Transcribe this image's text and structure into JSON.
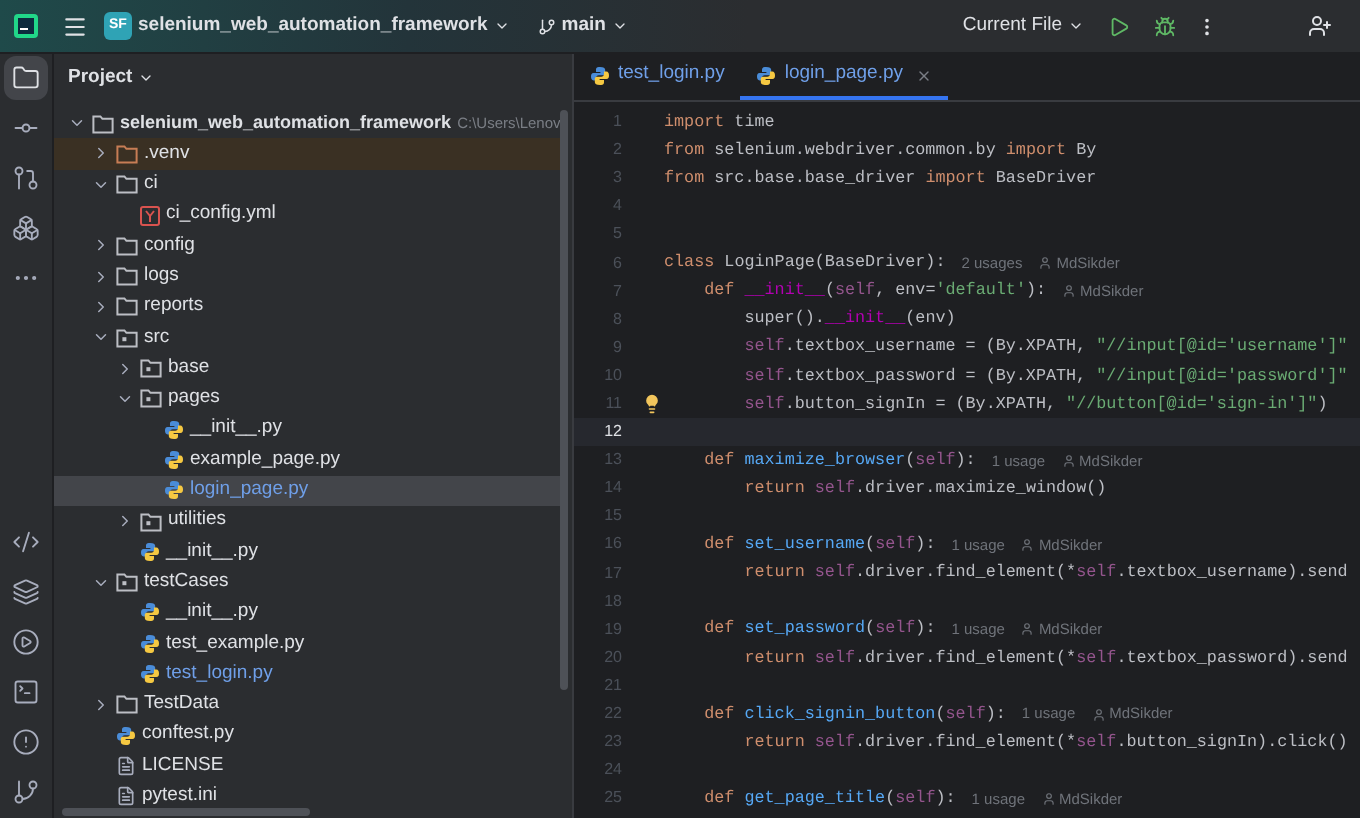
{
  "toolbar": {
    "project_badge": "SF",
    "project_name": "selenium_web_automation_framework",
    "branch": "main",
    "run_config": "Current File"
  },
  "left_tools": {
    "top": [
      {
        "selected": true
      },
      {
        "selected": false
      },
      {
        "selected": false
      },
      {
        "selected": false
      },
      {
        "selected": false
      }
    ],
    "bottom": [
      {
        "selected": false
      },
      {
        "selected": false
      },
      {
        "selected": false
      },
      {
        "selected": false
      },
      {
        "selected": false
      },
      {
        "selected": false
      }
    ]
  },
  "project_panel": {
    "title": "Project",
    "tree": [
      {
        "kind": "root",
        "name": "selenium_web_automation_framework",
        "path": "C:\\Users\\Lenov",
        "expanded": true,
        "selected": false,
        "children": [
          {
            "kind": "folder",
            "name": ".venv",
            "expanded": false,
            "excluded": true,
            "selected": false
          },
          {
            "kind": "folder",
            "name": "ci",
            "expanded": true,
            "selected": false,
            "children": [
              {
                "kind": "yaml",
                "name": "ci_config.yml",
                "selected": false
              }
            ]
          },
          {
            "kind": "folder",
            "name": "config",
            "expanded": false,
            "selected": false
          },
          {
            "kind": "folder",
            "name": "logs",
            "expanded": false,
            "selected": false
          },
          {
            "kind": "folder",
            "name": "reports",
            "expanded": false,
            "selected": false
          },
          {
            "kind": "package",
            "name": "src",
            "expanded": true,
            "selected": false,
            "children": [
              {
                "kind": "package",
                "name": "base",
                "expanded": false,
                "selected": false
              },
              {
                "kind": "package",
                "name": "pages",
                "expanded": true,
                "selected": false,
                "children": [
                  {
                    "kind": "python",
                    "name": "__init__.py",
                    "selected": false,
                    "modified": false
                  },
                  {
                    "kind": "python",
                    "name": "example_page.py",
                    "selected": false,
                    "modified": false
                  },
                  {
                    "kind": "python",
                    "name": "login_page.py",
                    "selected": true,
                    "modified": true
                  }
                ]
              },
              {
                "kind": "package",
                "name": "utilities",
                "expanded": false,
                "selected": false
              },
              {
                "kind": "python",
                "name": "__init__.py",
                "selected": false,
                "modified": false
              }
            ]
          },
          {
            "kind": "package",
            "name": "testCases",
            "expanded": true,
            "selected": false,
            "children": [
              {
                "kind": "python",
                "name": "__init__.py",
                "selected": false,
                "modified": false
              },
              {
                "kind": "python",
                "name": "test_example.py",
                "selected": false,
                "modified": false
              },
              {
                "kind": "python",
                "name": "test_login.py",
                "selected": false,
                "modified": true
              }
            ]
          },
          {
            "kind": "folder",
            "name": "TestData",
            "expanded": false,
            "selected": false
          },
          {
            "kind": "python",
            "name": "conftest.py",
            "selected": false,
            "modified": false
          },
          {
            "kind": "text",
            "name": "LICENSE",
            "selected": false
          },
          {
            "kind": "text",
            "name": "pytest.ini",
            "selected": false
          }
        ]
      }
    ]
  },
  "tabs": [
    {
      "label": "test_login.py",
      "selected": false,
      "modified": true
    },
    {
      "label": "login_page.py",
      "selected": true,
      "modified": true
    }
  ],
  "editor": {
    "lines": [
      {
        "number": "1",
        "current": false,
        "tokens": [
          {
            "t": "import",
            "kind": "kw"
          },
          {
            "t": " time",
            "kind": "plain"
          }
        ]
      },
      {
        "number": "2",
        "current": false,
        "tokens": [
          {
            "t": "from",
            "kind": "kw"
          },
          {
            "t": " selenium.webdriver.common.by ",
            "kind": "plain"
          },
          {
            "t": "import",
            "kind": "kw"
          },
          {
            "t": " By",
            "kind": "plain"
          }
        ]
      },
      {
        "number": "3",
        "current": false,
        "tokens": [
          {
            "t": "from",
            "kind": "kw"
          },
          {
            "t": " src.base.base_driver ",
            "kind": "plain"
          },
          {
            "t": "import",
            "kind": "kw"
          },
          {
            "t": " BaseDriver",
            "kind": "plain"
          }
        ]
      },
      {
        "number": "4",
        "current": false
      },
      {
        "number": "5",
        "current": false
      },
      {
        "number": "6",
        "current": false,
        "tokens": [
          {
            "t": "class",
            "kind": "kw"
          },
          {
            "t": " LoginPage(BaseDriver):",
            "kind": "plain"
          }
        ],
        "hints": [
          {
            "kind": "usages",
            "text": "2 usages"
          },
          {
            "kind": "author",
            "text": "MdSikder"
          }
        ]
      },
      {
        "number": "7",
        "current": false,
        "tokens": [
          {
            "t": "    def ",
            "kind": "kw"
          },
          {
            "t": "__init__",
            "kind": "dunder"
          },
          {
            "t": "(",
            "kind": "plain"
          },
          {
            "t": "self",
            "kind": "self"
          },
          {
            "t": ", env=",
            "kind": "plain"
          },
          {
            "t": "'default'",
            "kind": "str"
          },
          {
            "t": "):",
            "kind": "plain"
          }
        ],
        "hints": [
          {
            "kind": "author",
            "text": "MdSikder"
          }
        ]
      },
      {
        "number": "8",
        "current": false,
        "tokens": [
          {
            "t": "        super().",
            "kind": "plain"
          },
          {
            "t": "__init__",
            "kind": "dunder"
          },
          {
            "t": "(env)",
            "kind": "plain"
          }
        ]
      },
      {
        "number": "9",
        "current": false,
        "tokens": [
          {
            "t": "        self",
            "kind": "self"
          },
          {
            "t": ".textbox_username = (By.XPATH, ",
            "kind": "plain"
          },
          {
            "t": "\"//input[@id='username']\"",
            "kind": "str"
          }
        ]
      },
      {
        "number": "10",
        "current": false,
        "tokens": [
          {
            "t": "        self",
            "kind": "self"
          },
          {
            "t": ".textbox_password = (By.XPATH, ",
            "kind": "plain"
          },
          {
            "t": "\"//input[@id='password']\"",
            "kind": "str"
          }
        ]
      },
      {
        "number": "11",
        "current": false,
        "bulb": true,
        "tokens": [
          {
            "t": "        self",
            "kind": "self"
          },
          {
            "t": ".button_signIn = (By.XPATH, ",
            "kind": "plain"
          },
          {
            "t": "\"//button[@id='sign-in']\"",
            "kind": "str"
          },
          {
            "t": ")",
            "kind": "plain"
          }
        ]
      },
      {
        "number": "12",
        "current": true
      },
      {
        "number": "13",
        "current": false,
        "tokens": [
          {
            "t": "    def ",
            "kind": "kw"
          },
          {
            "t": "maximize_browser",
            "kind": "fn"
          },
          {
            "t": "(",
            "kind": "plain"
          },
          {
            "t": "self",
            "kind": "self"
          },
          {
            "t": "):",
            "kind": "plain"
          }
        ],
        "hints": [
          {
            "kind": "usages",
            "text": "1 usage"
          },
          {
            "kind": "author",
            "text": "MdSikder"
          }
        ]
      },
      {
        "number": "14",
        "current": false,
        "tokens": [
          {
            "t": "        return ",
            "kind": "kw"
          },
          {
            "t": "self",
            "kind": "self"
          },
          {
            "t": ".driver.maximize_window()",
            "kind": "plain"
          }
        ]
      },
      {
        "number": "15",
        "current": false
      },
      {
        "number": "16",
        "current": false,
        "tokens": [
          {
            "t": "    def ",
            "kind": "kw"
          },
          {
            "t": "set_username",
            "kind": "fn"
          },
          {
            "t": "(",
            "kind": "plain"
          },
          {
            "t": "self",
            "kind": "self"
          },
          {
            "t": "):",
            "kind": "plain"
          }
        ],
        "hints": [
          {
            "kind": "usages",
            "text": "1 usage"
          },
          {
            "kind": "author",
            "text": "MdSikder"
          }
        ]
      },
      {
        "number": "17",
        "current": false,
        "tokens": [
          {
            "t": "        return ",
            "kind": "kw"
          },
          {
            "t": "self",
            "kind": "self"
          },
          {
            "t": ".driver.find_element(*",
            "kind": "plain"
          },
          {
            "t": "self",
            "kind": "self"
          },
          {
            "t": ".textbox_username).send",
            "kind": "plain"
          }
        ]
      },
      {
        "number": "18",
        "current": false
      },
      {
        "number": "19",
        "current": false,
        "tokens": [
          {
            "t": "    def ",
            "kind": "kw"
          },
          {
            "t": "set_password",
            "kind": "fn"
          },
          {
            "t": "(",
            "kind": "plain"
          },
          {
            "t": "self",
            "kind": "self"
          },
          {
            "t": "):",
            "kind": "plain"
          }
        ],
        "hints": [
          {
            "kind": "usages",
            "text": "1 usage"
          },
          {
            "kind": "author",
            "text": "MdSikder"
          }
        ]
      },
      {
        "number": "20",
        "current": false,
        "tokens": [
          {
            "t": "        return ",
            "kind": "kw"
          },
          {
            "t": "self",
            "kind": "self"
          },
          {
            "t": ".driver.find_element(*",
            "kind": "plain"
          },
          {
            "t": "self",
            "kind": "self"
          },
          {
            "t": ".textbox_password).send",
            "kind": "plain"
          }
        ]
      },
      {
        "number": "21",
        "current": false
      },
      {
        "number": "22",
        "current": false,
        "tokens": [
          {
            "t": "    def ",
            "kind": "kw"
          },
          {
            "t": "click_signin_button",
            "kind": "fn"
          },
          {
            "t": "(",
            "kind": "plain"
          },
          {
            "t": "self",
            "kind": "self"
          },
          {
            "t": "):",
            "kind": "plain"
          }
        ],
        "hints": [
          {
            "kind": "usages",
            "text": "1 usage"
          },
          {
            "kind": "author",
            "text": "MdSikder"
          }
        ]
      },
      {
        "number": "23",
        "current": false,
        "tokens": [
          {
            "t": "        return ",
            "kind": "kw"
          },
          {
            "t": "self",
            "kind": "self"
          },
          {
            "t": ".driver.find_element(*",
            "kind": "plain"
          },
          {
            "t": "self",
            "kind": "self"
          },
          {
            "t": ".button_signIn).click()",
            "kind": "plain"
          }
        ]
      },
      {
        "number": "24",
        "current": false
      },
      {
        "number": "25",
        "current": false,
        "tokens": [
          {
            "t": "    def ",
            "kind": "kw"
          },
          {
            "t": "get_page_title",
            "kind": "fn"
          },
          {
            "t": "(",
            "kind": "plain"
          },
          {
            "t": "self",
            "kind": "self"
          },
          {
            "t": "):",
            "kind": "plain"
          }
        ],
        "hints": [
          {
            "kind": "usages",
            "text": "1 usage"
          },
          {
            "kind": "author",
            "text": "MdSikder"
          }
        ]
      }
    ]
  }
}
